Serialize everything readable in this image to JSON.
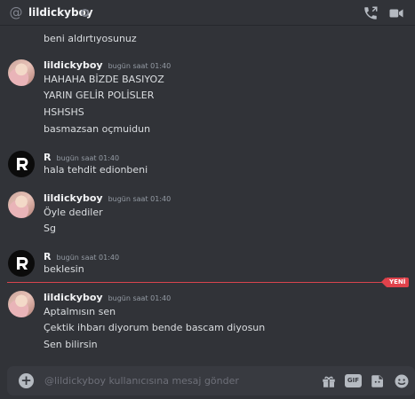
{
  "header": {
    "title": "lildickyboy"
  },
  "messages": {
    "m0": {
      "text": "beni aldırtıyosunuz"
    },
    "g1": {
      "author": "lildickyboy",
      "time": "bugün saat 01:40",
      "lines": [
        "HAHAHA BİZDE BASIYOZ",
        "YARIN GELİR POLİSLER",
        "HSHSHS",
        "basmazsan oçmuidun"
      ]
    },
    "g2": {
      "author": "R",
      "time": "bugün saat 01:40",
      "lines": [
        "hala tehdit edionbeni"
      ]
    },
    "g3": {
      "author": "lildickyboy",
      "time": "bugün saat 01:40",
      "lines": [
        "Öyle dediler",
        "Sg"
      ]
    },
    "g4": {
      "author": "R",
      "time": "bugün saat 01:40",
      "lines": [
        "beklesin"
      ]
    },
    "new_label": "YENİ",
    "g5": {
      "author": "lildickyboy",
      "time": "bugün saat 01:40",
      "lines": [
        "Aptalmısın sen",
        "Çektik ihbarı diyorum bende bascam diyosun",
        "Sen bilirsin"
      ]
    }
  },
  "composer": {
    "placeholder": "@lildickyboy kullanıcısına mesaj gönder",
    "value": "",
    "gif_label": "GIF",
    "icons": [
      "add-icon",
      "gift-icon",
      "gif-icon",
      "sticker-icon",
      "emoji-icon"
    ]
  },
  "colors": {
    "background": "#313338",
    "input_bg": "#383a40",
    "new_divider": "#d9444e",
    "avatar_r_bg": "#0b0b0b"
  }
}
